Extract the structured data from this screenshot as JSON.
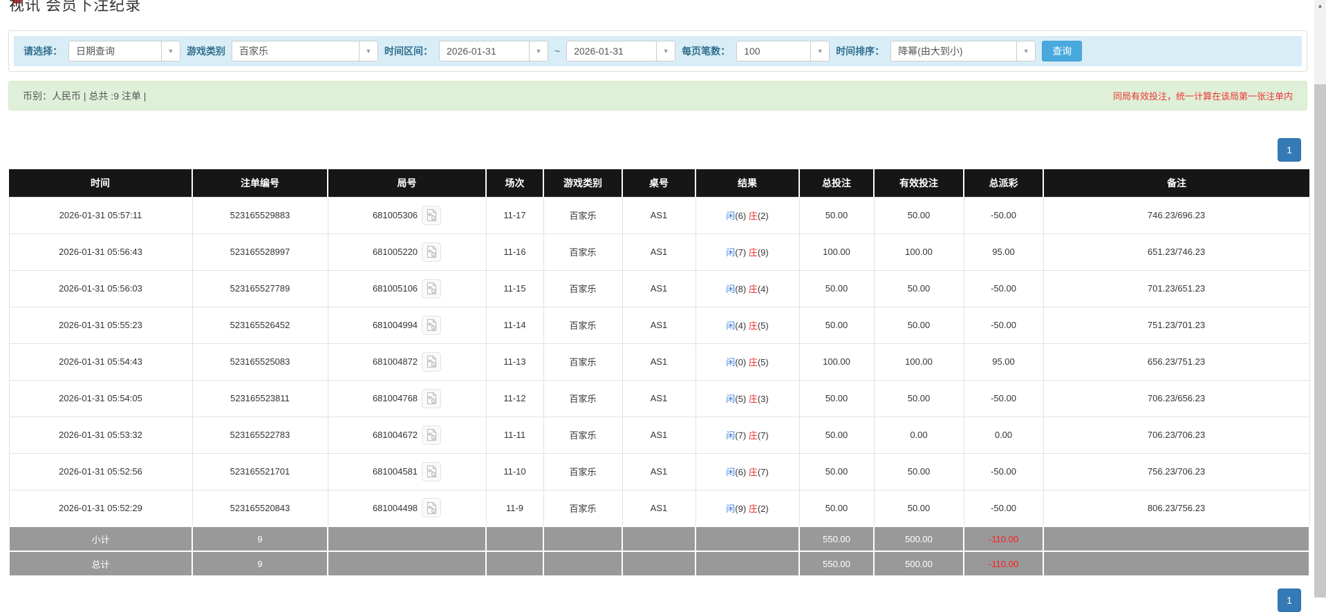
{
  "page": {
    "title": "视讯 会员下注纪录"
  },
  "filters": {
    "select_label": "请选择：",
    "select_value": "日期查询",
    "game_label": "游戏类别",
    "game_value": "百家乐",
    "range_label": "时间区间：",
    "date_from": "2026-01-31",
    "tilde": "~",
    "date_to": "2026-01-31",
    "page_size_label": "每页笔数：",
    "page_size_value": "100",
    "sort_label": "时间排序：",
    "sort_value": "降幂(由大到小)",
    "search_button": "查询"
  },
  "summary_bar": {
    "left": "币别：人民币 | 总共 :9 注单 |",
    "right": "同局有效投注，统一计算在该局第一张注单内"
  },
  "pagination": {
    "page": "1"
  },
  "icons": {
    "dropdown_arrow": "▼",
    "scroll_up": "▲"
  },
  "colors": {
    "accent": "#49a9dd",
    "link_blue": "#3b7dd8",
    "banker_red": "#e62e2e",
    "header_bg": "#161616",
    "totals_bg": "#999999",
    "summary_bg": "#dff0d8",
    "filter_bg": "#d9edf7",
    "pager_bg": "#337ab7"
  },
  "table": {
    "headers": [
      "时间",
      "注单编号",
      "局号",
      "场次",
      "游戏类别",
      "桌号",
      "结果",
      "总投注",
      "有效投注",
      "总派彩",
      "备注"
    ],
    "rows": [
      {
        "time": "2026-01-31 05:57:11",
        "bet_no": "523165529883",
        "round_no": "681005306",
        "session": "11-17",
        "game": "百家乐",
        "table_no": "AS1",
        "result": {
          "player": "闲",
          "player_pts": "(6)",
          "banker": "庄",
          "banker_pts": "(2)"
        },
        "total_bet": "50.00",
        "valid_bet": "50.00",
        "payout": "-50.00",
        "remark": "746.23/696.23"
      },
      {
        "time": "2026-01-31 05:56:43",
        "bet_no": "523165528997",
        "round_no": "681005220",
        "session": "11-16",
        "game": "百家乐",
        "table_no": "AS1",
        "result": {
          "player": "闲",
          "player_pts": "(7)",
          "banker": "庄",
          "banker_pts": "(9)"
        },
        "total_bet": "100.00",
        "valid_bet": "100.00",
        "payout": "95.00",
        "remark": "651.23/746.23"
      },
      {
        "time": "2026-01-31 05:56:03",
        "bet_no": "523165527789",
        "round_no": "681005106",
        "session": "11-15",
        "game": "百家乐",
        "table_no": "AS1",
        "result": {
          "player": "闲",
          "player_pts": "(8)",
          "banker": "庄",
          "banker_pts": "(4)"
        },
        "total_bet": "50.00",
        "valid_bet": "50.00",
        "payout": "-50.00",
        "remark": "701.23/651.23"
      },
      {
        "time": "2026-01-31 05:55:23",
        "bet_no": "523165526452",
        "round_no": "681004994",
        "session": "11-14",
        "game": "百家乐",
        "table_no": "AS1",
        "result": {
          "player": "闲",
          "player_pts": "(4)",
          "banker": "庄",
          "banker_pts": "(5)"
        },
        "total_bet": "50.00",
        "valid_bet": "50.00",
        "payout": "-50.00",
        "remark": "751.23/701.23"
      },
      {
        "time": "2026-01-31 05:54:43",
        "bet_no": "523165525083",
        "round_no": "681004872",
        "session": "11-13",
        "game": "百家乐",
        "table_no": "AS1",
        "result": {
          "player": "闲",
          "player_pts": "(0)",
          "banker": "庄",
          "banker_pts": "(5)"
        },
        "total_bet": "100.00",
        "valid_bet": "100.00",
        "payout": "95.00",
        "remark": "656.23/751.23"
      },
      {
        "time": "2026-01-31 05:54:05",
        "bet_no": "523165523811",
        "round_no": "681004768",
        "session": "11-12",
        "game": "百家乐",
        "table_no": "AS1",
        "result": {
          "player": "闲",
          "player_pts": "(5)",
          "banker": "庄",
          "banker_pts": "(3)"
        },
        "total_bet": "50.00",
        "valid_bet": "50.00",
        "payout": "-50.00",
        "remark": "706.23/656.23"
      },
      {
        "time": "2026-01-31 05:53:32",
        "bet_no": "523165522783",
        "round_no": "681004672",
        "session": "11-11",
        "game": "百家乐",
        "table_no": "AS1",
        "result": {
          "player": "闲",
          "player_pts": "(7)",
          "banker": "庄",
          "banker_pts": "(7)"
        },
        "total_bet": "50.00",
        "valid_bet": "0.00",
        "payout": "0.00",
        "remark": "706.23/706.23"
      },
      {
        "time": "2026-01-31 05:52:56",
        "bet_no": "523165521701",
        "round_no": "681004581",
        "session": "11-10",
        "game": "百家乐",
        "table_no": "AS1",
        "result": {
          "player": "闲",
          "player_pts": "(6)",
          "banker": "庄",
          "banker_pts": "(7)"
        },
        "total_bet": "50.00",
        "valid_bet": "50.00",
        "payout": "-50.00",
        "remark": "756.23/706.23"
      },
      {
        "time": "2026-01-31 05:52:29",
        "bet_no": "523165520843",
        "round_no": "681004498",
        "session": "11-9",
        "game": "百家乐",
        "table_no": "AS1",
        "result": {
          "player": "闲",
          "player_pts": "(9)",
          "banker": "庄",
          "banker_pts": "(2)"
        },
        "total_bet": "50.00",
        "valid_bet": "50.00",
        "payout": "-50.00",
        "remark": "806.23/756.23"
      }
    ],
    "subtotal": {
      "cells": [
        "小计",
        "9",
        "",
        "",
        "",
        "",
        "",
        "550.00",
        "500.00",
        "-110.00",
        ""
      ]
    },
    "total": {
      "cells": [
        "总计",
        "9",
        "",
        "",
        "",
        "",
        "",
        "550.00",
        "500.00",
        "-110.00",
        ""
      ]
    }
  }
}
